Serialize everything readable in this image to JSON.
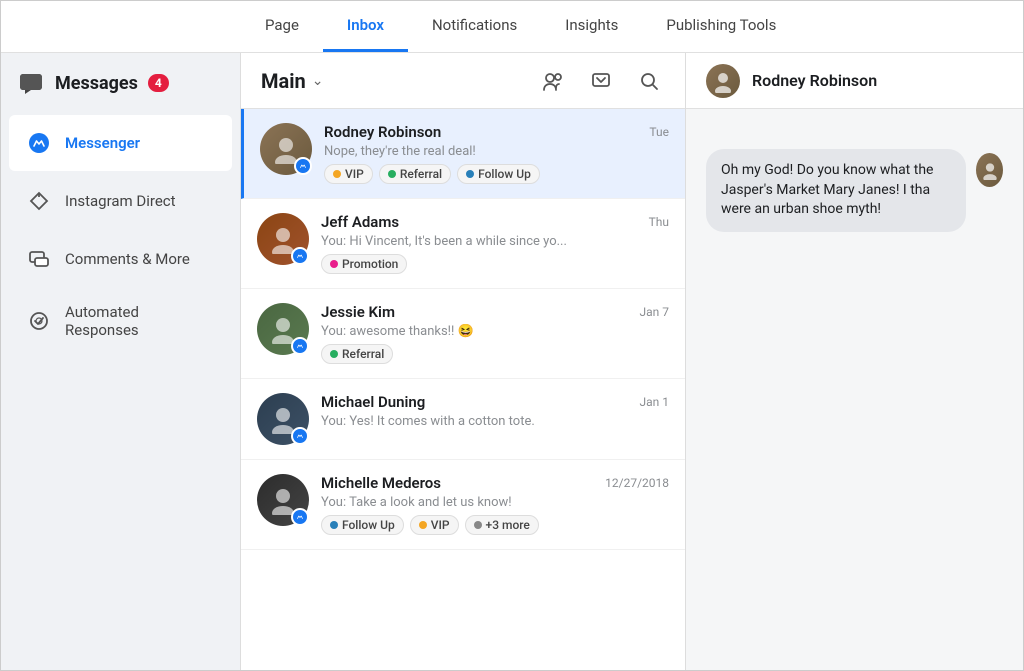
{
  "topNav": {
    "items": [
      {
        "label": "Page",
        "active": false
      },
      {
        "label": "Inbox",
        "active": true
      },
      {
        "label": "Notifications",
        "active": false
      },
      {
        "label": "Insights",
        "active": false
      },
      {
        "label": "Publishing Tools",
        "active": false
      }
    ]
  },
  "sidebar": {
    "title": "Messages",
    "badge": "4",
    "items": [
      {
        "label": "Messenger",
        "icon": "messenger"
      },
      {
        "label": "Instagram Direct",
        "icon": "instagram"
      },
      {
        "label": "Comments & More",
        "icon": "comments"
      },
      {
        "label": "Automated Responses",
        "icon": "automated"
      }
    ]
  },
  "inbox": {
    "title": "Main",
    "conversations": [
      {
        "name": "Rodney Robinson",
        "time": "Tue",
        "preview": "Nope, they're the real deal!",
        "tags": [
          {
            "label": "VIP",
            "color": "#f4a623"
          },
          {
            "label": "Referral",
            "color": "#27ae60"
          },
          {
            "label": "Follow Up",
            "color": "#2980b9"
          }
        ],
        "active": true,
        "avatarClass": "av-rodney"
      },
      {
        "name": "Jeff Adams",
        "time": "Thu",
        "preview": "You: Hi Vincent, It's been a while since yo...",
        "tags": [
          {
            "label": "Promotion",
            "color": "#e91e8c"
          }
        ],
        "active": false,
        "avatarClass": "av-jeff"
      },
      {
        "name": "Jessie Kim",
        "time": "Jan 7",
        "preview": "You: awesome thanks!! 😆",
        "tags": [
          {
            "label": "Referral",
            "color": "#27ae60"
          }
        ],
        "active": false,
        "avatarClass": "av-jessie"
      },
      {
        "name": "Michael Duning",
        "time": "Jan 1",
        "preview": "You: Yes! It comes with a cotton tote.",
        "tags": [],
        "active": false,
        "avatarClass": "av-michael"
      },
      {
        "name": "Michelle Mederos",
        "time": "12/27/2018",
        "preview": "You: Take a look and let us know!",
        "tags": [
          {
            "label": "Follow Up",
            "color": "#2980b9"
          },
          {
            "label": "VIP",
            "color": "#f4a623"
          },
          {
            "label": "+3 more",
            "color": "#888"
          }
        ],
        "active": false,
        "avatarClass": "av-michelle"
      }
    ]
  },
  "rightPanel": {
    "name": "Rodney Robinson",
    "message": "Oh my God! Do you know what the Jasper's Market Mary Janes! I tha were an urban shoe myth!"
  }
}
